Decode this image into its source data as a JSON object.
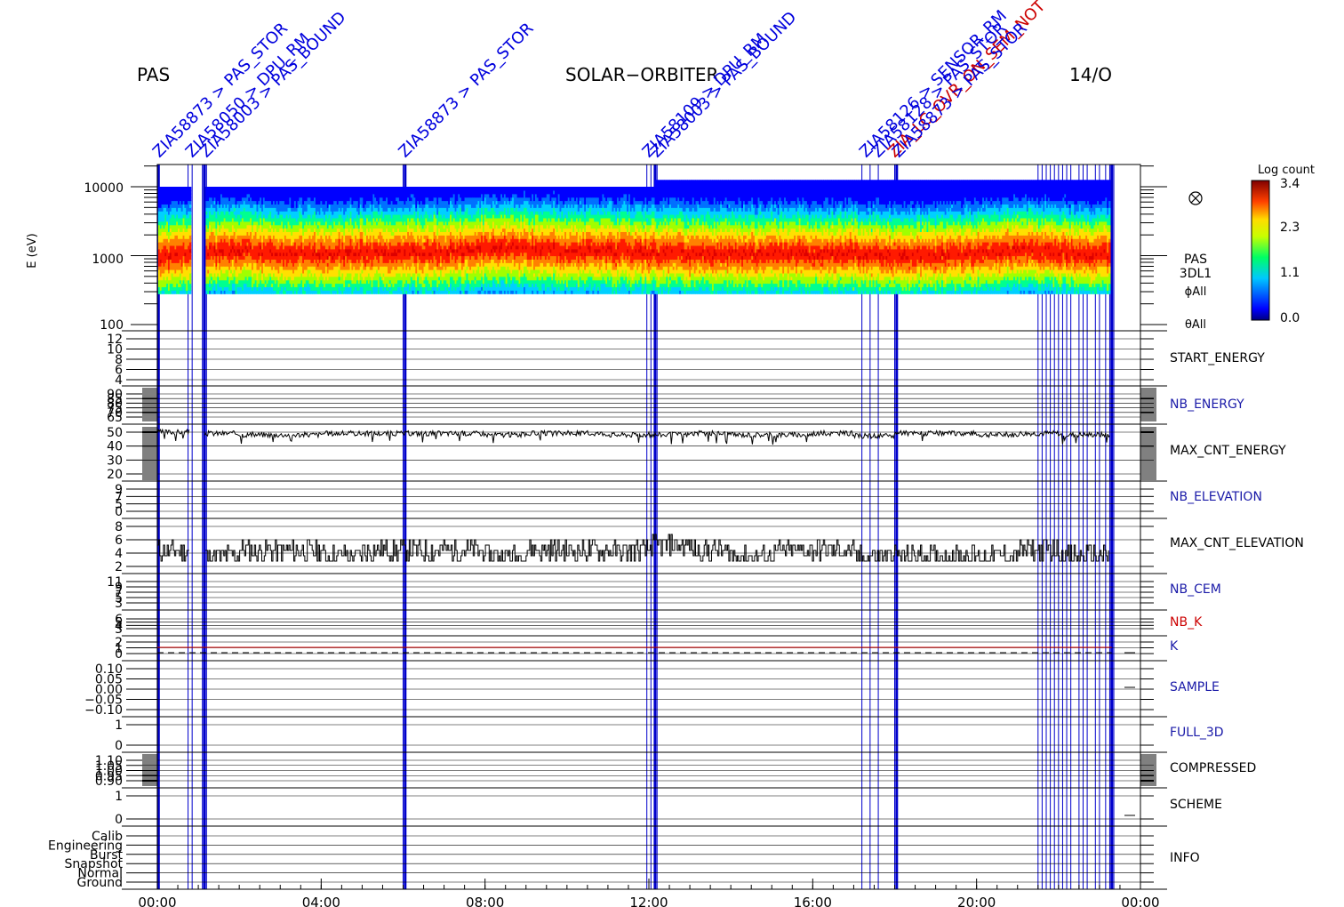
{
  "header": {
    "instrument": "PAS",
    "mission": "SOLAR−ORBITER",
    "date": "14/O"
  },
  "spectrogram": {
    "ylabel": "E (eV)",
    "yticks": [
      "10000",
      "1000",
      "100"
    ],
    "right_labels": [
      "PAS",
      "3DL1",
      "ϕAll",
      "θAll"
    ],
    "direction_icon": "circle-cross-icon",
    "colorbar": {
      "title": "Log count",
      "ticks": [
        "3.4",
        "2.3",
        "1.1",
        "0.0"
      ]
    }
  },
  "time_axis": {
    "ticks": [
      "00:00",
      "04:00",
      "08:00",
      "12:00",
      "16:00",
      "20:00",
      "00:00"
    ]
  },
  "panels": [
    {
      "name": "START_ENERGY",
      "color": "#000000",
      "ticks": [
        "12",
        "10",
        "8",
        "6",
        "4"
      ]
    },
    {
      "name": "NB_ENERGY",
      "color": "#1a1aa8",
      "ticks": [
        "90",
        "85",
        "80",
        "75",
        "70",
        "65"
      ]
    },
    {
      "name": "MAX_CNT_ENERGY",
      "color": "#000000",
      "ticks": [
        "50",
        "40",
        "30",
        "20"
      ]
    },
    {
      "name": "NB_ELEVATION",
      "color": "#1a1aa8",
      "ticks": [
        "9",
        "7",
        "5",
        "0"
      ]
    },
    {
      "name": "MAX_CNT_ELEVATION",
      "color": "#000000",
      "ticks": [
        "8",
        "6",
        "4",
        "2"
      ]
    },
    {
      "name": "NB_CEM",
      "color": "#1a1aa8",
      "ticks": [
        "11",
        "9",
        "7",
        "5",
        "3"
      ]
    },
    {
      "name": "NB_K",
      "color": "#cc0000",
      "ticks": [
        "6",
        "5",
        "4",
        "3"
      ]
    },
    {
      "name": "K",
      "color": "#1a1aa8",
      "ticks": [
        "2",
        "1",
        "0"
      ]
    },
    {
      "name": "SAMPLE",
      "color": "#1a1aa8",
      "ticks": [
        "0.10",
        "0.05",
        "0.00",
        "−0.05",
        "−0.10"
      ]
    },
    {
      "name": "FULL_3D",
      "color": "#1a1aa8",
      "ticks": [
        "1",
        "0"
      ]
    },
    {
      "name": "COMPRESSED",
      "color": "#000000",
      "ticks": [
        "1.10",
        "1.05",
        "1.00",
        "0.95",
        "0.90"
      ]
    },
    {
      "name": "SCHEME",
      "color": "#000000",
      "ticks": [
        "1",
        "0"
      ]
    },
    {
      "name": "INFO",
      "color": "#000000",
      "ticks": [
        "Calib",
        "Engineering",
        "Burst",
        "Snapshot",
        "Normal",
        "Ground"
      ]
    }
  ],
  "event_labels": [
    {
      "hour": 0.05,
      "text": "ZIA58873 > PAS_STOR",
      "color": "#0000dd"
    },
    {
      "hour": 0.85,
      "text": "ZIA58050 > DPU_RM",
      "color": "#0000dd"
    },
    {
      "hour": 1.2,
      "text": "ZIA58003 > PAS_BOUND",
      "color": "#0000dd"
    },
    {
      "hour": 6.05,
      "text": "ZIA58873 > PAS_STOR",
      "color": "#0000dd"
    },
    {
      "hour": 12.0,
      "text": "ZIA58109 > DPU_RM",
      "color": "#0000dd"
    },
    {
      "hour": 12.2,
      "text": "ZIA58003 > PAS_BOUND",
      "color": "#0000dd"
    },
    {
      "hour": 17.3,
      "text": "ZIA58126 > SENSOR_RM",
      "color": "#0000dd"
    },
    {
      "hour": 17.6,
      "text": "ZIA58128 > PAS_STOR",
      "color": "#0000dd"
    },
    {
      "hour": 18.0,
      "text": "ZIA_LC_OVR_ON_SEM_NOT",
      "color": "#cc0000"
    },
    {
      "hour": 18.1,
      "text": "ZIA58873 > PAS_STOR",
      "color": "#0000dd"
    }
  ],
  "chart_data": [
    {
      "type": "heatmap",
      "title": "PAS 3DL1",
      "xlabel": "",
      "ylabel": "E (eV)",
      "xlim_hours": [
        0,
        24
      ],
      "ylim": [
        100,
        20000
      ],
      "yscale": "log",
      "colorbar": {
        "label": "Log count",
        "range": [
          0.0,
          3.4
        ]
      },
      "peak_energy_eV": [
        [
          0.0,
          900
        ],
        [
          1.0,
          1050
        ],
        [
          2.0,
          1100
        ],
        [
          3.0,
          1000
        ],
        [
          4.0,
          1000
        ],
        [
          5.0,
          1050
        ],
        [
          6.0,
          1050
        ],
        [
          7.0,
          1050
        ],
        [
          8.0,
          1200
        ],
        [
          9.0,
          1200
        ],
        [
          10.0,
          1100
        ],
        [
          11.0,
          1100
        ],
        [
          12.0,
          1050
        ],
        [
          13.0,
          1000
        ],
        [
          14.0,
          1000
        ],
        [
          15.0,
          1000
        ],
        [
          16.0,
          1000
        ],
        [
          17.0,
          1000
        ],
        [
          18.0,
          950
        ],
        [
          19.0,
          950
        ],
        [
          20.0,
          1000
        ],
        [
          21.0,
          1150
        ],
        [
          22.0,
          1050
        ],
        [
          23.0,
          1000
        ]
      ],
      "data_gaps_hours": [
        [
          0.8,
          1.15
        ],
        [
          23.25,
          24.0
        ]
      ]
    },
    {
      "type": "line",
      "name": "MAX_CNT_ENERGY",
      "ylim": [
        15,
        55
      ],
      "x_hours": [
        0,
        1,
        2,
        3,
        4,
        5,
        6,
        7,
        8,
        9,
        10,
        11,
        12,
        13,
        14,
        15,
        16,
        17,
        18,
        19,
        20,
        21,
        22,
        23
      ],
      "values": [
        51,
        50,
        49,
        49,
        50,
        50,
        50,
        50,
        49,
        50,
        50,
        49,
        49,
        50,
        49,
        49,
        50,
        48,
        50,
        50,
        49,
        50,
        49,
        51
      ]
    },
    {
      "type": "line",
      "name": "MAX_CNT_ELEVATION",
      "ylim": [
        1,
        9
      ],
      "x_hours": [
        0,
        1,
        2,
        3,
        4,
        5,
        6,
        7,
        8,
        9,
        10,
        11,
        12,
        13,
        14,
        15,
        16,
        17,
        18,
        19,
        20,
        21,
        22,
        23
      ],
      "values": [
        4,
        3,
        4,
        4,
        3,
        4,
        4,
        4,
        3,
        4,
        4,
        4,
        5,
        4,
        3,
        4,
        4,
        3,
        3,
        3,
        3,
        4,
        3,
        4
      ]
    }
  ]
}
